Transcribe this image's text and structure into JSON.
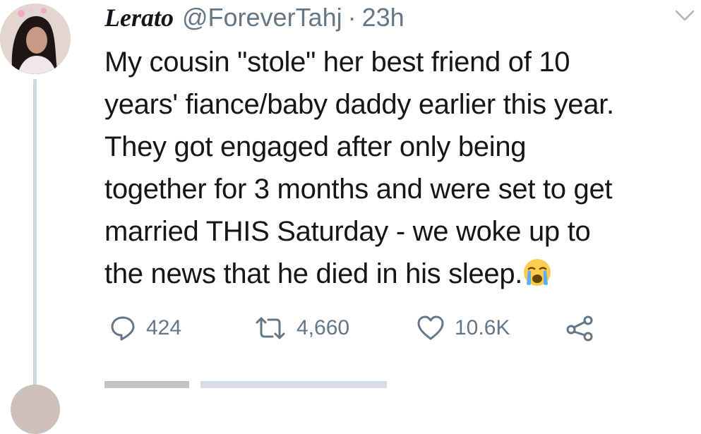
{
  "tweet": {
    "author_name": "Lerato",
    "author_handle": "@ForeverTahj",
    "separator": "·",
    "time": "23h",
    "lines": [
      "My cousin \"stole\" her best friend of 10",
      "years' fiance/baby daddy earlier this year.",
      "They got engaged after only being",
      "together for 3 months and were set to get",
      "married THIS Saturday - we woke up to",
      "the news that he died in his sleep."
    ],
    "emoji": "loudly-crying-face"
  },
  "actions": {
    "reply_count": "424",
    "retweet_count": "4,660",
    "like_count": "10.6K"
  },
  "icons": {
    "reply": "speech-bubble-icon",
    "retweet": "retweet-icon",
    "like": "heart-icon",
    "share": "share-icon",
    "menu": "chevron-down-icon"
  },
  "colors": {
    "text": "#14171a",
    "muted": "#657786",
    "thread_line": "#ccd6dd"
  }
}
